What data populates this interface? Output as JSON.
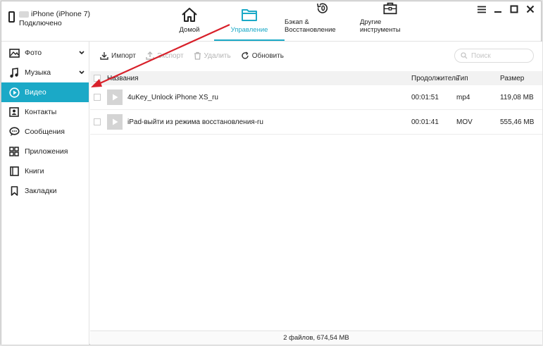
{
  "device": {
    "name": "iPhone (iPhone 7)",
    "status": "Подключено"
  },
  "nav": {
    "tabs": [
      {
        "label": "Домой",
        "icon": "home-icon",
        "active": false
      },
      {
        "label": "Управление",
        "icon": "folder-icon",
        "active": true
      },
      {
        "label": "Бэкап & Восстановление",
        "icon": "backup-restore-icon",
        "active": false
      },
      {
        "label": "Другие инструменты",
        "icon": "toolbox-icon",
        "active": false
      }
    ]
  },
  "window_controls": [
    "menu-icon",
    "minimize-icon",
    "maximize-icon",
    "close-icon"
  ],
  "sidebar": {
    "items": [
      {
        "label": "Фото",
        "icon": "photo-icon",
        "expandable": true,
        "active": false
      },
      {
        "label": "Музыка",
        "icon": "music-icon",
        "expandable": true,
        "active": false
      },
      {
        "label": "Видео",
        "icon": "video-play-icon",
        "expandable": false,
        "active": true
      },
      {
        "label": "Контакты",
        "icon": "contacts-icon",
        "expandable": false,
        "active": false
      },
      {
        "label": "Сообщения",
        "icon": "messages-icon",
        "expandable": false,
        "active": false
      },
      {
        "label": "Приложения",
        "icon": "apps-icon",
        "expandable": false,
        "active": false
      },
      {
        "label": "Книги",
        "icon": "books-icon",
        "expandable": false,
        "active": false
      },
      {
        "label": "Закладки",
        "icon": "bookmarks-icon",
        "expandable": false,
        "active": false
      }
    ]
  },
  "toolbar": {
    "import_label": "Импорт",
    "export_label": "Экспорт",
    "delete_label": "Удалить",
    "refresh_label": "Обновить"
  },
  "search": {
    "placeholder": "Поиск",
    "value": ""
  },
  "table": {
    "headers": {
      "name": "Названия",
      "duration": "Продолжитель",
      "type": "Тип",
      "size": "Размер"
    },
    "rows": [
      {
        "name": "4uKey_Unlock iPhone XS_ru",
        "duration": "00:01:51",
        "type": "mp4",
        "size": "119,08 MB"
      },
      {
        "name": "iPad-выйти из режима восстановления-ru",
        "duration": "00:01:41",
        "type": "MOV",
        "size": "555,46 MB"
      }
    ]
  },
  "status": {
    "summary": "2 файлов, 674,54 MB"
  },
  "colors": {
    "accent": "#1ba9c7",
    "annotation_arrow": "#d8202a"
  }
}
